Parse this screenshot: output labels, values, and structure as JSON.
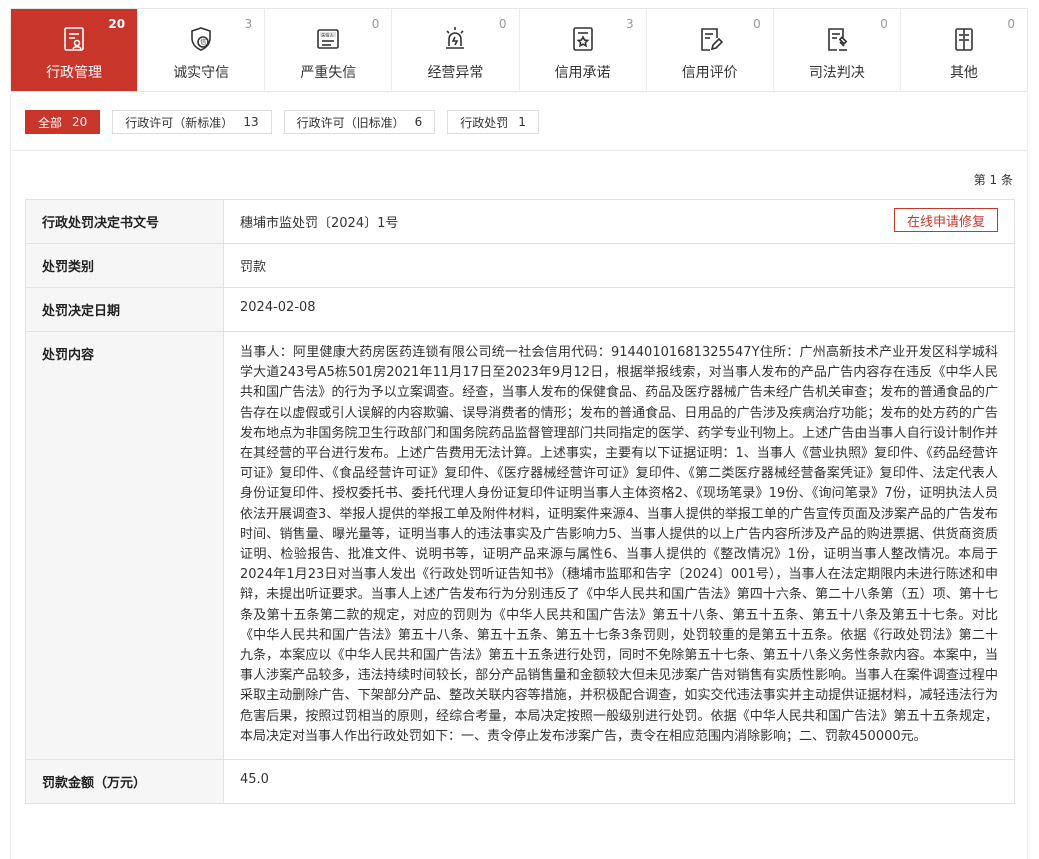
{
  "tabs": [
    {
      "label": "行政管理",
      "count": "20",
      "icon": "admin-doc-icon",
      "active": true
    },
    {
      "label": "诚实守信",
      "count": "3",
      "icon": "shield-credit-icon",
      "active": false
    },
    {
      "label": "严重失信",
      "count": "0",
      "icon": "dishonest-list-icon",
      "active": false
    },
    {
      "label": "经营异常",
      "count": "0",
      "icon": "alarm-light-icon",
      "active": false
    },
    {
      "label": "信用承诺",
      "count": "3",
      "icon": "promise-star-icon",
      "active": false
    },
    {
      "label": "信用评价",
      "count": "0",
      "icon": "evaluation-edit-icon",
      "active": false
    },
    {
      "label": "司法判决",
      "count": "0",
      "icon": "judgment-hammer-icon",
      "active": false
    },
    {
      "label": "其他",
      "count": "0",
      "icon": "other-doc-icon",
      "active": false
    }
  ],
  "filters": [
    {
      "label": "全部",
      "count": "20",
      "active": true
    },
    {
      "label": "行政许可（新标准）",
      "count": "13",
      "active": false
    },
    {
      "label": "行政许可（旧标准）",
      "count": "6",
      "active": false
    },
    {
      "label": "行政处罚",
      "count": "1",
      "active": false
    }
  ],
  "page_info": "第 1 条",
  "repair_button": "在线申请修复",
  "record": {
    "doc_no_label": "行政处罚决定书文号",
    "doc_no": "穗埔市监处罚〔2024〕1号",
    "category_label": "处罚类别",
    "category": "罚款",
    "date_label": "处罚决定日期",
    "date": "2024-02-08",
    "content_label": "处罚内容",
    "content": "当事人：阿里健康大药房医药连锁有限公司统一社会信用代码：91440101681325547Y住所：广州高新技术产业开发区科学城科学大道243号A5栋501房2021年11月17日至2023年9月12日，根据举报线索，对当事人发布的产品广告内容存在违反《中华人民共和国广告法》的行为予以立案调查。经查，当事人发布的保健食品、药品及医疗器械广告未经广告机关审查；发布的普通食品的广告存在以虚假或引人误解的内容欺骗、误导消费者的情形；发布的普通食品、日用品的广告涉及疾病治疗功能；发布的处方药的广告发布地点为非国务院卫生行政部门和国务院药品监督管理部门共同指定的医学、药学专业刊物上。上述广告由当事人自行设计制作并在其经营的平台进行发布。上述广告费用无法计算。上述事实，主要有以下证据证明：1、当事人《营业执照》复印件、《药品经营许可证》复印件、《食品经营许可证》复印件、《医疗器械经营许可证》复印件、《第二类医疗器械经营备案凭证》复印件、法定代表人身份证复印件、授权委托书、委托代理人身份证复印件证明当事人主体资格2、《现场笔录》19份、《询问笔录》7份，证明执法人员依法开展调查3、举报人提供的举报工单及附件材料，证明案件来源4、当事人提供的举报工单的广告宣传页面及涉案产品的广告发布时间、销售量、曝光量等，证明当事人的违法事实及广告影响力5、当事人提供的以上广告内容所涉及产品的购进票据、供货商资质证明、检验报告、批准文件、说明书等，证明产品来源与属性6、当事人提供的《整改情况》1份，证明当事人整改情况。本局于2024年1月23日对当事人发出《行政处罚听证告知书》（穗埔市监耶和告字〔2024〕001号），当事人在法定期限内未进行陈述和申辩，未提出听证要求。当事人上述广告发布行为分别违反了《中华人民共和国广告法》第四十六条、第二十八条第（五）项、第十七条及第十五条第二款的规定，对应的罚则为《中华人民共和国广告法》第五十八条、第五十五条、第五十八条及第五十七条。对比《中华人民共和国广告法》第五十八条、第五十五条、第五十七条3条罚则，处罚较重的是第五十五条。依据《行政处罚法》第二十九条，本案应以《中华人民共和国广告法》第五十五条进行处罚，同时不免除第五十七条、第五十八条义务性条款内容。本案中，当事人涉案产品较多，违法持续时间较长，部分产品销售量和金额较大但未见涉案广告对销售有实质性影响。当事人在案件调查过程中采取主动删除广告、下架部分产品、整改关联内容等措施，并积极配合调查，如实交代违法事实并主动提供证据材料，减轻违法行为危害后果，按照过罚相当的原则，经综合考量，本局决定按照一般级别进行处罚。依据《中华人民共和国广告法》第五十五条规定，本局决定对当事人作出行政处罚如下：一、责令停止发布涉案广告，责令在相应范围内消除影响；二、罚款450000元。",
    "amount_label": "罚款金额（万元）",
    "amount": "45.0"
  },
  "colors": {
    "accent": "#c8352b",
    "label_bg": "#f6f6f6"
  }
}
